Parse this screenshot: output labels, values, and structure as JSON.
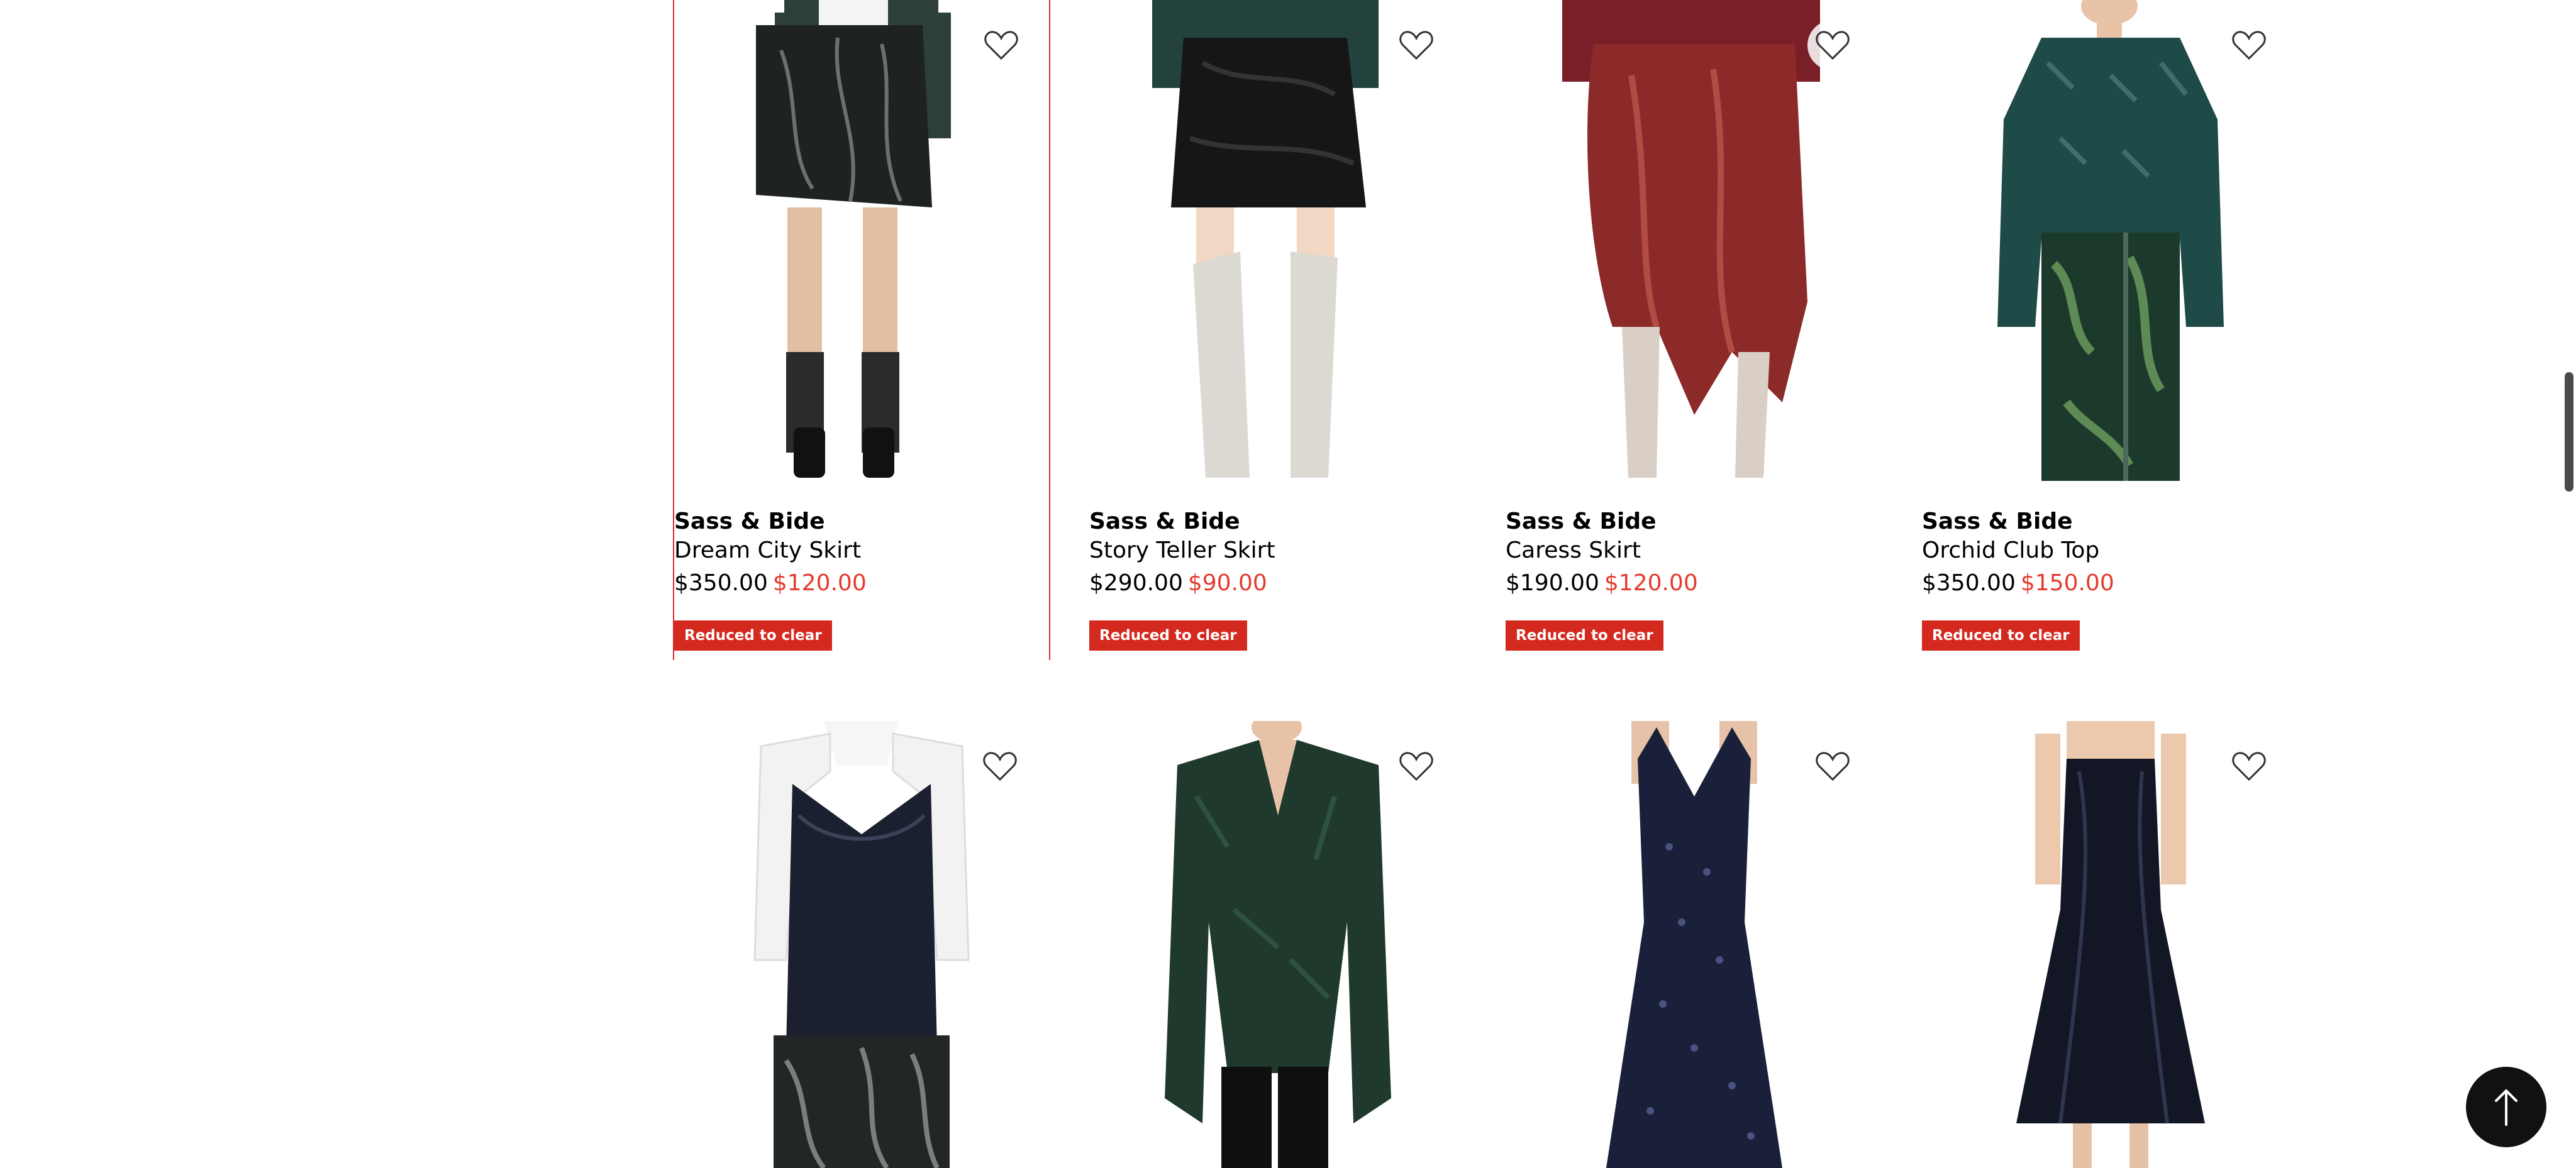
{
  "products": [
    {
      "brand": "Sass & Bide",
      "name": "Dream City Skirt",
      "was_price": "$350.00",
      "now_price": "$120.00",
      "badge": "Reduced to clear"
    },
    {
      "brand": "Sass & Bide",
      "name": "Story Teller Skirt",
      "was_price": "$290.00",
      "now_price": "$90.00",
      "badge": "Reduced to clear"
    },
    {
      "brand": "Sass & Bide",
      "name": "Caress Skirt",
      "was_price": "$190.00",
      "now_price": "$120.00",
      "badge": "Reduced to clear"
    },
    {
      "brand": "Sass & Bide",
      "name": "Orchid Club Top",
      "was_price": "$350.00",
      "now_price": "$150.00",
      "badge": "Reduced to clear"
    }
  ],
  "icons": {
    "wishlist": "heart-outline-icon",
    "back_to_top": "arrow-up-icon"
  },
  "colors": {
    "sale_price": "#e33b2e",
    "badge_bg": "#d4291f",
    "selected_border": "#d92b2b"
  }
}
